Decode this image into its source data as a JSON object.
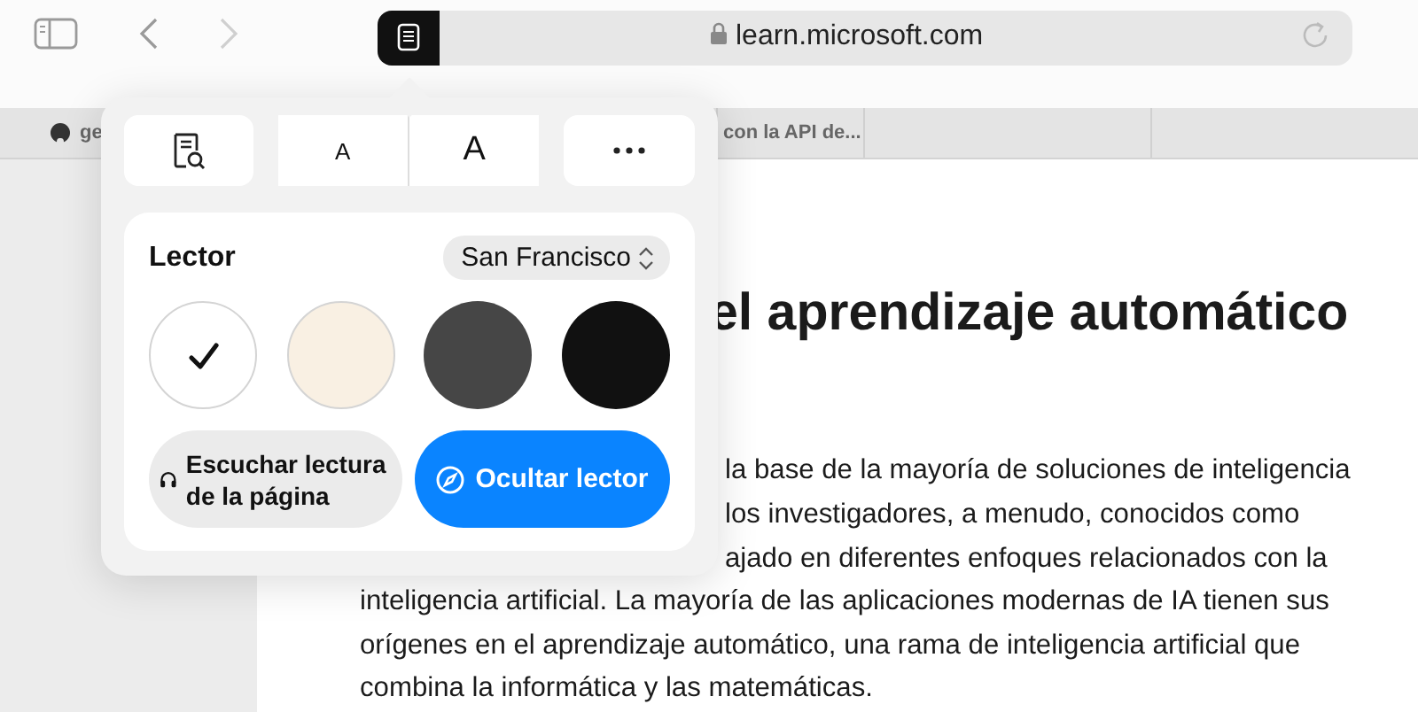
{
  "toolbar": {
    "address": "learn.microsoft.com"
  },
  "tabs": [
    {
      "label": "ge"
    },
    {
      "label": "con la API de..."
    }
  ],
  "article": {
    "heading": "el aprendizaje automático",
    "lines": [
      "la base de la mayoría de soluciones de inteligencia",
      "los investigadores, a menudo, conocidos como",
      "ajado en diferentes enfoques relacionados con la",
      "inteligencia artificial. La mayoría de las aplicaciones modernas de IA tienen sus",
      "orígenes en el aprendizaje automático, una rama de inteligencia artificial que",
      "combina la informática y las matemáticas."
    ]
  },
  "reader_popover": {
    "font_sizes": [
      "A",
      "A"
    ],
    "title": "Lector",
    "font": "San Francisco",
    "themes": [
      {
        "color": "#ffffff",
        "selected": true
      },
      {
        "color": "#f9f0e3",
        "selected": false
      },
      {
        "color": "#464646",
        "selected": false
      },
      {
        "color": "#111111",
        "selected": false
      }
    ],
    "listen_button": "Escuchar lectura de la página",
    "hide_button": "Ocultar lector"
  }
}
